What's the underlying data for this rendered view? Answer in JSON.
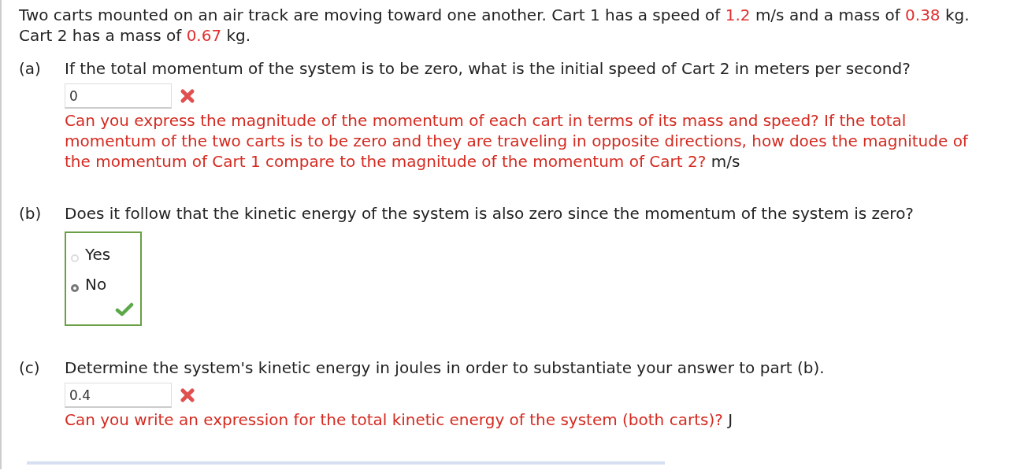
{
  "intro": [
    {
      "text": "Two carts mounted on an air track are moving toward one another. Cart 1 has a speed of ",
      "highlight": false
    },
    {
      "text": "1.2",
      "highlight": true
    },
    {
      "text": " m/s and a mass of ",
      "highlight": false
    },
    {
      "text": "0.38",
      "highlight": true
    },
    {
      "text": " kg. Cart 2 has a mass of ",
      "highlight": false
    },
    {
      "text": "0.67",
      "highlight": true
    },
    {
      "text": " kg.",
      "highlight": false
    }
  ],
  "parts": [
    {
      "kind": "numeric",
      "label": "(a)",
      "question": "If the total momentum of the system is to be zero, what is the initial speed of Cart 2 in meters per second?",
      "answer": "0",
      "correct": false,
      "feedback": "Can you express the magnitude of the momentum of each cart in terms of its mass and speed? If the total momentum of the two carts is to be zero and they are traveling in opposite directions, how does the magnitude of the momentum of Cart 1 compare to the magnitude of the momentum of Cart 2?",
      "unit": "m/s"
    },
    {
      "kind": "choice",
      "label": "(b)",
      "question": "Does it follow that the kinetic energy of the system is also zero since the momentum of the system is zero?",
      "correct": true,
      "options": [
        {
          "label": "Yes",
          "selected": false
        },
        {
          "label": "No",
          "selected": true
        }
      ]
    },
    {
      "kind": "numeric",
      "label": "(c)",
      "question": "Determine the system's kinetic energy in joules in order to substantiate your answer to part (b).",
      "answer": "0.4",
      "correct": false,
      "feedback": "Can you write an expression for the total kinetic energy of the system (both carts)?",
      "unit": "J"
    }
  ]
}
